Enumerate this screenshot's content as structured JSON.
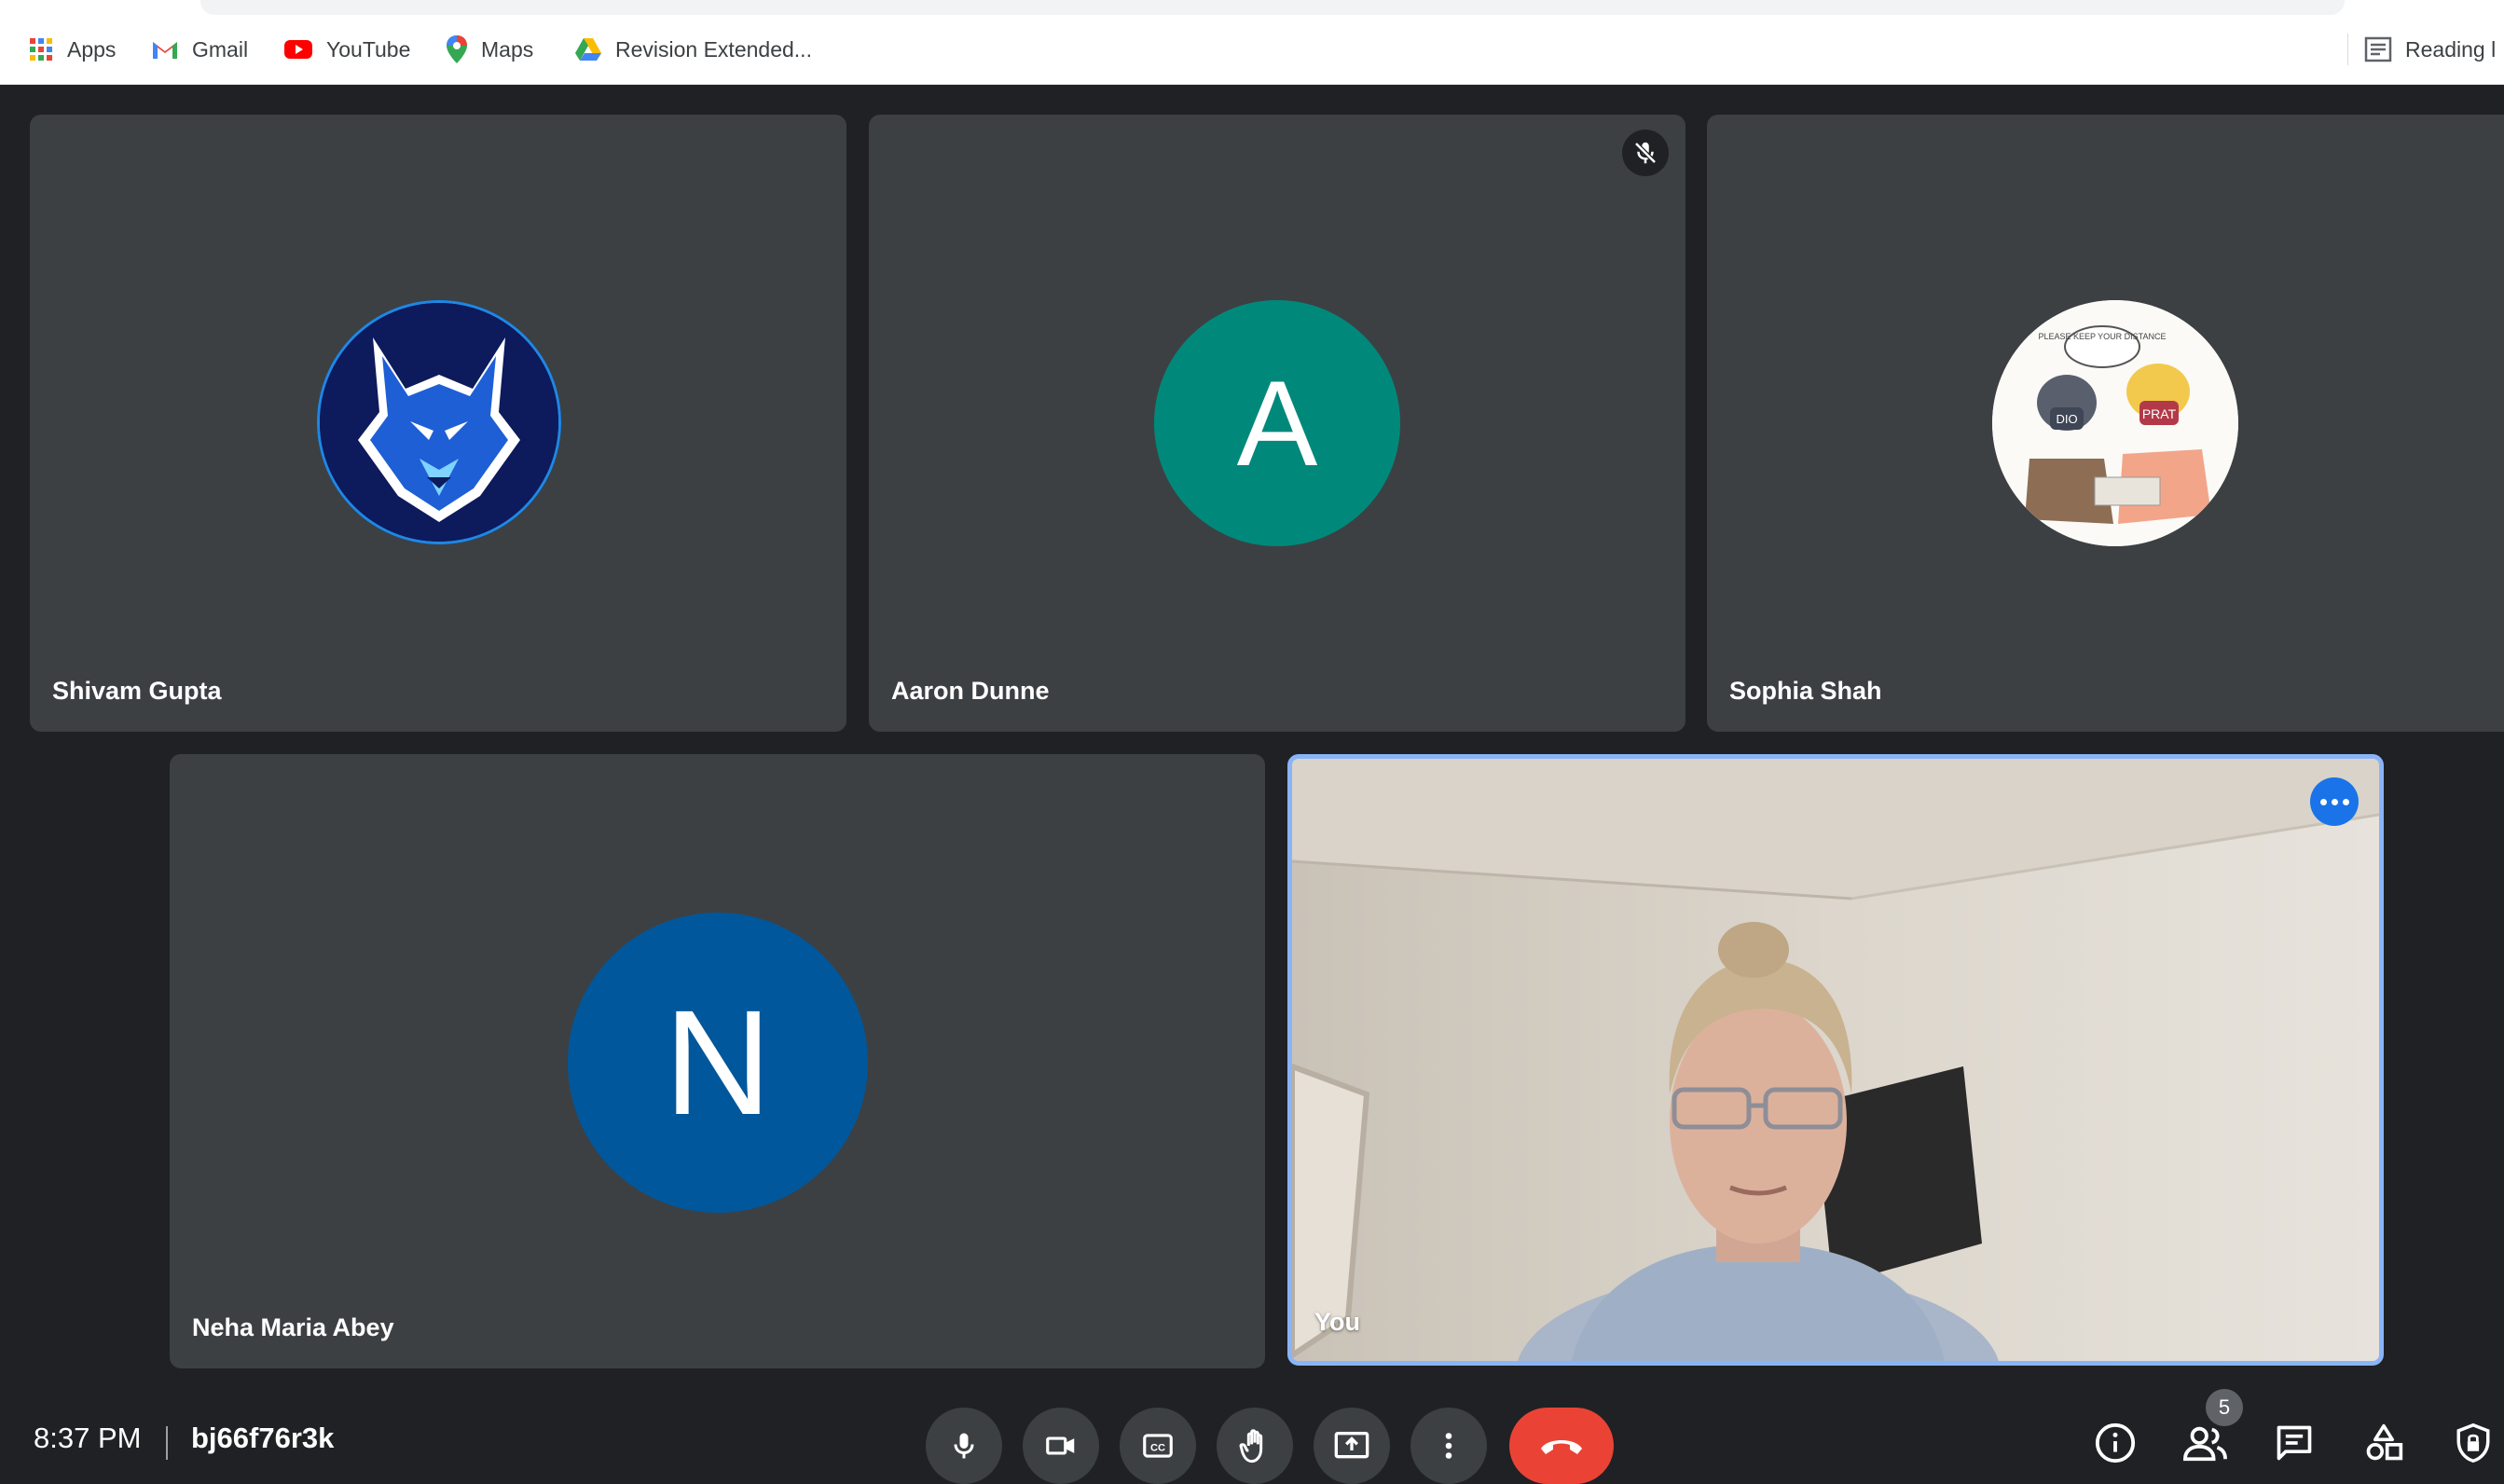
{
  "bookmarks": [
    {
      "label": "Apps",
      "icon": "apps-grid-icon"
    },
    {
      "label": "Gmail",
      "icon": "gmail-icon"
    },
    {
      "label": "YouTube",
      "icon": "youtube-icon"
    },
    {
      "label": "Maps",
      "icon": "maps-pin-icon"
    },
    {
      "label": "Revision Extended...",
      "icon": "google-drive-icon"
    }
  ],
  "reading_list_label": "Reading l",
  "participants": [
    {
      "name": "Shivam Gupta",
      "avatar_type": "image",
      "avatar_desc": "wolf-logo"
    },
    {
      "name": "Aaron Dunne",
      "avatar_type": "letter",
      "initial": "A",
      "color": "#00897b",
      "muted": true
    },
    {
      "name": "Sophia Shah",
      "avatar_type": "image",
      "avatar_desc": "comic-drawing"
    },
    {
      "name": "Neha Maria Abey",
      "avatar_type": "letter",
      "initial": "N",
      "color": "#01579b"
    },
    {
      "name": "You",
      "avatar_type": "video"
    }
  ],
  "comic_text": {
    "bubble": "PLEASE KEEP YOUR DISTANCE",
    "mask_left": "DIO",
    "mask_right": "PRAT"
  },
  "meeting": {
    "time": "8:37 PM",
    "code": "bj66f76r3k"
  },
  "controls": [
    "mic-icon",
    "camera-icon",
    "captions-icon",
    "raise-hand-icon",
    "present-icon",
    "more-options-icon",
    "hang-up-icon"
  ],
  "right_controls": [
    "info-icon",
    "people-icon",
    "chat-icon",
    "activities-icon",
    "host-controls-icon"
  ],
  "people_count": "5",
  "colors": {
    "background": "#202124",
    "tile": "#3c4043",
    "hangup": "#ea4335",
    "self_border": "#8ab4f8",
    "more": "#1a73e8"
  }
}
